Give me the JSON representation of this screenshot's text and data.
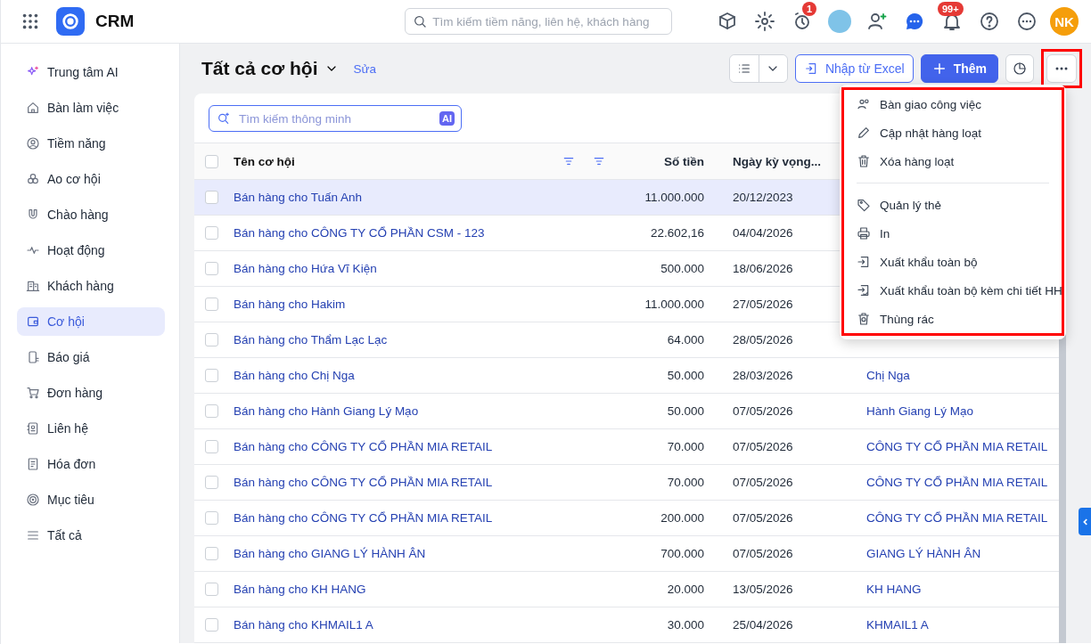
{
  "app": {
    "name": "CRM"
  },
  "search": {
    "placeholder": "Tìm kiếm tiềm năng, liên hệ, khách hàng"
  },
  "header": {
    "alarm_badge": "1",
    "notification_badge": "99+",
    "user_initials": "NK"
  },
  "sidebar": {
    "items": [
      {
        "label": "Trung tâm AI",
        "selected": false
      },
      {
        "label": "Bàn làm việc",
        "selected": false
      },
      {
        "label": "Tiềm năng",
        "selected": false
      },
      {
        "label": "Ao cơ hội",
        "selected": false
      },
      {
        "label": "Chào hàng",
        "selected": false
      },
      {
        "label": "Hoạt động",
        "selected": false
      },
      {
        "label": "Khách hàng",
        "selected": false
      },
      {
        "label": "Cơ hội",
        "selected": true
      },
      {
        "label": "Báo giá",
        "selected": false
      },
      {
        "label": "Đơn hàng",
        "selected": false
      },
      {
        "label": "Liên hệ",
        "selected": false
      },
      {
        "label": "Hóa đơn",
        "selected": false
      },
      {
        "label": "Mục tiêu",
        "selected": false
      },
      {
        "label": "Tất cả",
        "selected": false
      }
    ]
  },
  "page": {
    "title": "Tất cả cơ hội",
    "edit_link": "Sửa"
  },
  "toolbar": {
    "import_button": "Nhập từ Excel",
    "add_button": "Thêm",
    "more_highlighted": true
  },
  "smart_search": {
    "placeholder": "Tìm kiếm thông minh",
    "badge": "AI"
  },
  "table": {
    "all_selected": false,
    "columns": [
      "Tên cơ hội",
      "Số tiền",
      "Ngày kỳ vọng..."
    ],
    "rows": [
      {
        "name": "Bán hàng cho Tuấn Anh",
        "amount": "11.000.000",
        "date": "20/12/2023",
        "selected": true
      },
      {
        "name": "Bán hàng cho CÔNG TY CỔ PHẦN CSM - 123",
        "amount": "22.602,16",
        "date": "04/04/2026",
        "selected": false
      },
      {
        "name": "Bán hàng cho Hứa Vĩ Kiện",
        "amount": "500.000",
        "date": "18/06/2026",
        "selected": false
      },
      {
        "name": "Bán hàng cho Hakim",
        "amount": "11.000.000",
        "date": "27/05/2026",
        "selected": false
      },
      {
        "name": "Bán hàng cho Thẩm Lạc Lạc",
        "amount": "64.000",
        "date": "28/05/2026",
        "selected": false
      },
      {
        "name": "Bán hàng cho Chị Nga",
        "amount": "50.000",
        "date": "28/03/2026",
        "customer": "Chị Nga",
        "selected": false
      },
      {
        "name": "Bán hàng cho Hành Giang Lý Mạo",
        "amount": "50.000",
        "date": "07/05/2026",
        "customer": "Hành Giang Lý Mạo",
        "selected": false
      },
      {
        "name": "Bán hàng cho CÔNG TY CỔ PHẦN MIA RETAIL",
        "amount": "70.000",
        "date": "07/05/2026",
        "customer": "CÔNG TY CỔ PHẦN MIA RETAIL",
        "selected": false
      },
      {
        "name": "Bán hàng cho CÔNG TY CỔ PHẦN MIA RETAIL",
        "amount": "70.000",
        "date": "07/05/2026",
        "customer": "CÔNG TY CỔ PHẦN MIA RETAIL",
        "selected": false
      },
      {
        "name": "Bán hàng cho CÔNG TY CỔ PHẦN MIA RETAIL",
        "amount": "200.000",
        "date": "07/05/2026",
        "customer": "CÔNG TY CỔ PHẦN MIA RETAIL",
        "selected": false
      },
      {
        "name": "Bán hàng cho GIANG LÝ HÀNH ÂN",
        "amount": "700.000",
        "date": "07/05/2026",
        "customer": "GIANG LÝ HÀNH ÂN",
        "selected": false
      },
      {
        "name": "Bán hàng cho KH HANG",
        "amount": "20.000",
        "date": "13/05/2026",
        "customer": "KH HANG",
        "selected": false
      },
      {
        "name": "Bán hàng cho KHMAIL1 A",
        "amount": "30.000",
        "date": "25/04/2026",
        "customer": "KHMAIL1 A",
        "selected": false
      }
    ]
  },
  "menu": {
    "highlighted": true,
    "groups": [
      [
        {
          "label": "Bàn giao công việc"
        },
        {
          "label": "Cập nhật hàng loạt"
        },
        {
          "label": "Xóa hàng loạt"
        }
      ],
      [
        {
          "label": "Quản lý thẻ"
        },
        {
          "label": "In"
        },
        {
          "label": "Xuất khẩu toàn bộ"
        },
        {
          "label": "Xuất khẩu toàn bộ kèm chi tiết HH"
        },
        {
          "label": "Thùng rác"
        }
      ]
    ]
  }
}
